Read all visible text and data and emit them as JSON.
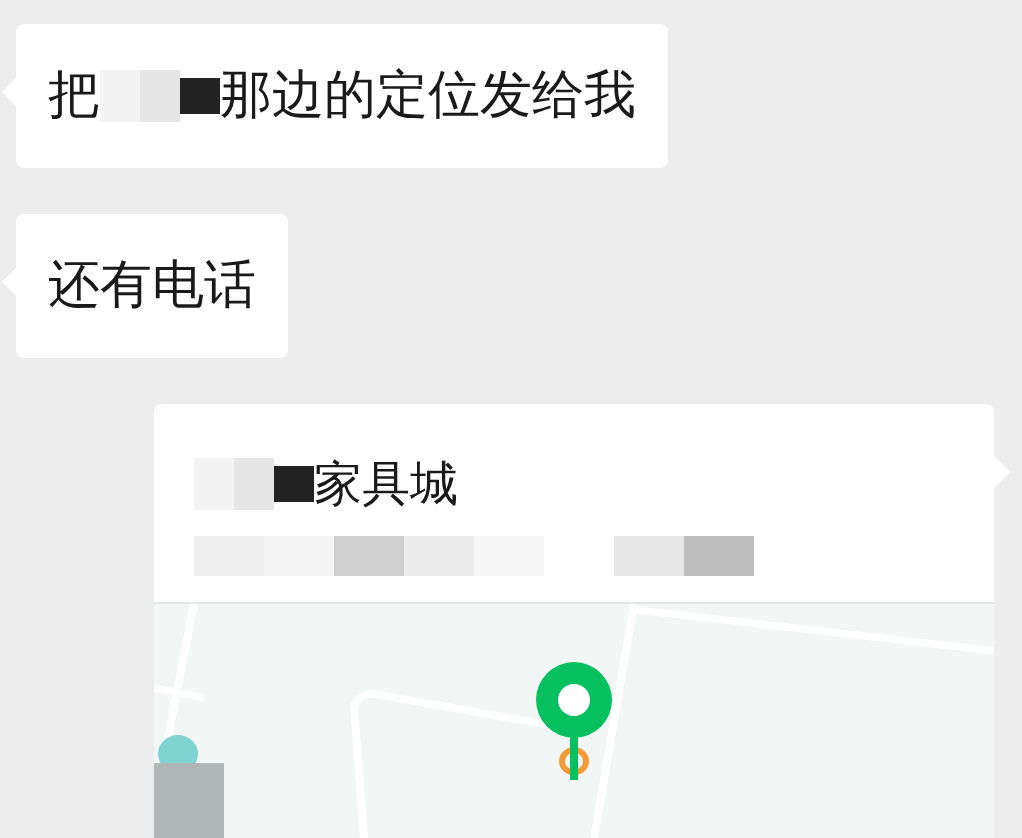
{
  "messages": [
    {
      "kind": "text",
      "segments": [
        {
          "kind": "text",
          "text": "把"
        },
        {
          "kind": "redaction"
        },
        {
          "kind": "text",
          "text": "那边的定位发给我"
        }
      ]
    },
    {
      "kind": "text",
      "segments": [
        {
          "kind": "text",
          "text": "还有电话"
        }
      ]
    },
    {
      "kind": "location",
      "title_segments": [
        {
          "kind": "redaction"
        },
        {
          "kind": "text",
          "text": "家具城"
        }
      ],
      "address_redacted": true,
      "map": {
        "kind": "picture"
      }
    }
  ]
}
